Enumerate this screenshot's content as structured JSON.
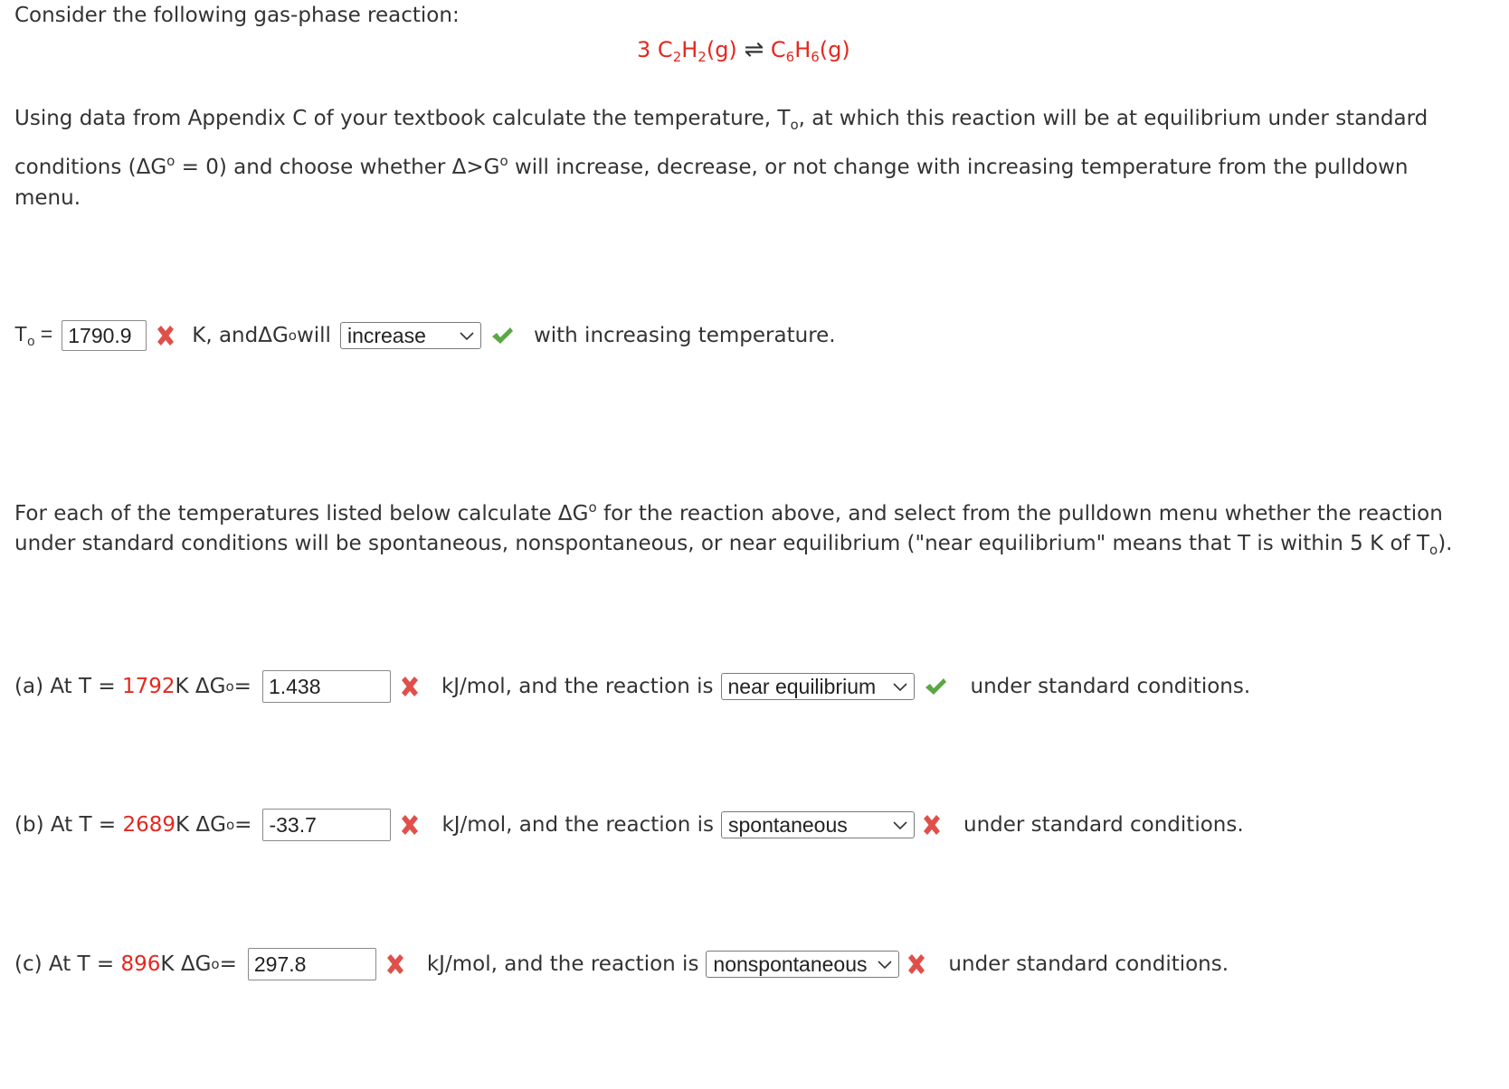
{
  "intro": "Consider the following gas-phase reaction:",
  "reaction": {
    "coef": "3",
    "reactant_a": "C",
    "reactant_sub1": "2",
    "reactant_b": "H",
    "reactant_sub2": "2",
    "reactant_phase": "(g)",
    "arrow": "⇌",
    "product_a": "C",
    "product_sub1": "6",
    "product_b": "H",
    "product_sub2": "6",
    "product_phase": "(g)",
    "color": "#e4281f"
  },
  "para1": {
    "line1_pre": "Using data from Appendix C of your textbook calculate the temperature, T",
    "line1_sub": "o",
    "line1_post": ", at which this reaction will be at equilibrium under standard",
    "line2_pre": "conditions (",
    "delta": "Δ",
    "g": "G",
    "deg": "o",
    "line2_mid": " = 0) and choose whether ",
    "gt": ">G",
    "line2_post": " will increase, decrease, or not change with increasing temperature from the pulldown",
    "line3": "menu."
  },
  "q0": {
    "label_t": "T",
    "label_sub": "o",
    "equals": " =",
    "input_value": "1790.9",
    "input_status": "incorrect",
    "mid_text": "K, and ",
    "will": " will",
    "select_value": "increase",
    "select_status": "correct",
    "post": "with increasing temperature."
  },
  "para2": {
    "line1_pre": "For each of the temperatures listed below calculate ",
    "line1_post": " for the reaction above, and select from the pulldown menu whether the reaction",
    "line2_pre": "under standard conditions will be spontaneous, nonspontaneous, or near equilibrium (\"near equilibrium\" means that T is within 5 K of T",
    "line2_sub": "o",
    "line2_post": ")."
  },
  "questions": [
    {
      "prefix": "(a) At T = ",
      "temp": "1792",
      "unit": " K ",
      "equals": " =",
      "input_value": "1.438",
      "input_status": "incorrect",
      "mid": "kJ/mol, and the reaction is",
      "select_value": "near equilibrium",
      "select_status": "correct",
      "post": "under standard conditions."
    },
    {
      "prefix": "(b) At T = ",
      "temp": "2689",
      "unit": " K ",
      "equals": " =",
      "input_value": "-33.7",
      "input_status": "incorrect",
      "mid": "kJ/mol, and the reaction is",
      "select_value": "spontaneous",
      "select_status": "incorrect",
      "post": "under standard conditions."
    },
    {
      "prefix": "(c) At T = ",
      "temp": "896",
      "unit": " K ",
      "equals": " =",
      "input_value": "297.8",
      "input_status": "incorrect",
      "mid": "kJ/mol, and the reaction is",
      "select_value": "nonspontaneous",
      "select_status": "incorrect",
      "post": "under standard conditions."
    }
  ],
  "colors": {
    "incorrect": "#e0504a",
    "correct": "#5aa843",
    "highlight": "#e4281f",
    "text": "#333333"
  }
}
